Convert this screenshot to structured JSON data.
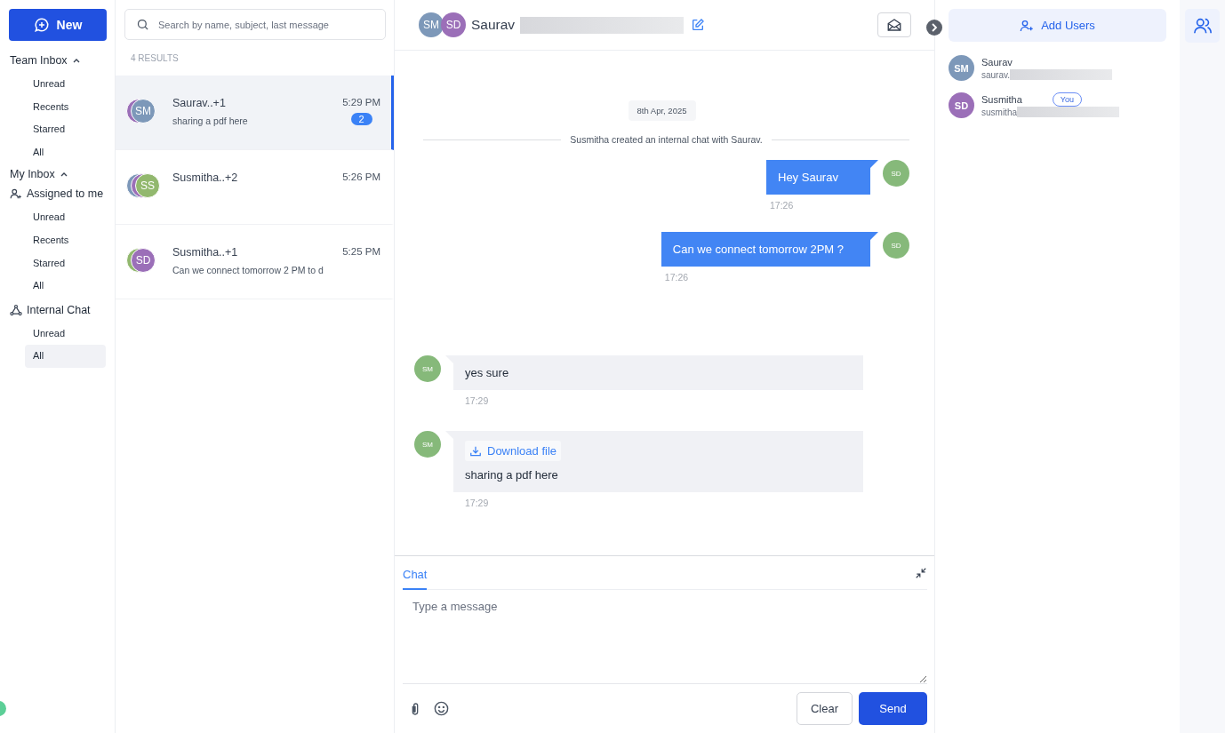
{
  "new_button": {
    "label": "New"
  },
  "nav_groups": [
    {
      "kind": "collapsible",
      "label": "Team Inbox",
      "expanded": true,
      "items": [
        {
          "label": "Unread",
          "selected": false
        },
        {
          "label": "Recents",
          "selected": false
        },
        {
          "label": "Starred",
          "selected": false
        },
        {
          "label": "All",
          "selected": false
        }
      ]
    },
    {
      "kind": "collapsible",
      "label": "My Inbox",
      "expanded": true
    },
    {
      "kind": "assigned",
      "label": "Assigned to me",
      "items": [
        {
          "label": "Unread",
          "selected": false
        },
        {
          "label": "Recents",
          "selected": false
        },
        {
          "label": "Starred",
          "selected": false
        },
        {
          "label": "All",
          "selected": false
        }
      ]
    },
    {
      "kind": "internal",
      "label": "Internal Chat",
      "items": [
        {
          "label": "Unread",
          "selected": false
        },
        {
          "label": "All",
          "selected": true
        }
      ]
    }
  ],
  "search": {
    "placeholder": "Search by name, subject, last message"
  },
  "results_count": "4 RESULTS",
  "conversations": [
    {
      "name": "Saurav..+1",
      "preview": "sharing a pdf here",
      "time": "5:29 PM",
      "unread": "2",
      "selected": true,
      "avatars": [
        {
          "color": "#9b6fb8"
        },
        {
          "initials": "SM",
          "color": "#7d98b9"
        }
      ]
    },
    {
      "name": "Susmitha..+2",
      "time": "5:26 PM",
      "selected": false,
      "avatars": [
        {
          "color": "#7d98b9"
        },
        {
          "color": "#9b6fb8"
        },
        {
          "initials": "SS",
          "color": "#92b86e"
        }
      ]
    },
    {
      "name": "Susmitha..+1",
      "preview": "Can we connect tomorrow 2 PM to d",
      "time": "5:25 PM",
      "selected": false,
      "avatars": [
        {
          "color": "#92b86e"
        },
        {
          "initials": "SD",
          "color": "#9b6fb8"
        }
      ]
    }
  ],
  "chat_header": {
    "name": "Saurav",
    "avatars": [
      {
        "initials": "SM",
        "color": "#7d98b9"
      },
      {
        "initials": "SD",
        "color": "#9b6fb8"
      }
    ]
  },
  "messages": [
    {
      "kind": "date",
      "text": "8th Apr, 2025"
    },
    {
      "kind": "system",
      "text": "Susmitha created an internal chat with Saurav."
    },
    {
      "kind": "outgoing",
      "text": "Hey Saurav",
      "time": "17:26",
      "avatar": {
        "initials": "SD",
        "color": "#86b97a"
      }
    },
    {
      "kind": "outgoing",
      "text": "Can we connect tomorrow 2PM ?",
      "time": "17:26",
      "avatar": {
        "initials": "SD",
        "color": "#86b97a"
      }
    },
    {
      "kind": "incoming",
      "text": "yes sure",
      "time": "17:29",
      "avatar": {
        "initials": "SM",
        "color": "#86b97a"
      }
    },
    {
      "kind": "incoming",
      "attachment": "Download file",
      "text": "sharing a pdf here",
      "time": "17:29",
      "avatar": {
        "initials": "SM",
        "color": "#86b97a"
      }
    }
  ],
  "composer": {
    "tabs": [
      {
        "label": "Chat",
        "selected": true
      }
    ],
    "placeholder": "Type a message",
    "clear": "Clear",
    "send": "Send"
  },
  "add_users": {
    "label": "Add Users"
  },
  "participants": [
    {
      "initials": "SM",
      "color": "#7d98b9",
      "name": "Saurav",
      "email": "saurav.",
      "you": false
    },
    {
      "initials": "SD",
      "color": "#9b6fb8",
      "name": "Susmitha",
      "email": "susmitha",
      "you": true,
      "you_label": "You"
    }
  ]
}
